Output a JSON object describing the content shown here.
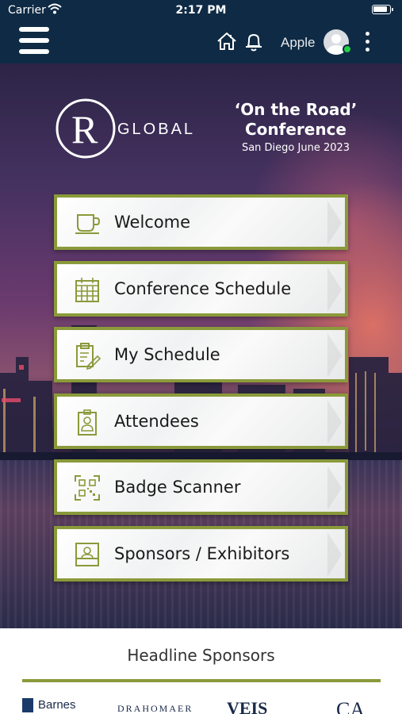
{
  "status_bar": {
    "carrier": "Carrier",
    "time": "2:17 PM"
  },
  "app_bar": {
    "user_name": "Apple",
    "icons": [
      "menu-icon",
      "home-icon",
      "bell-icon",
      "avatar-icon",
      "more-vertical-icon"
    ],
    "online_color": "#22d145"
  },
  "hero": {
    "logo_text": "GLOBAL",
    "logo_letter": "R",
    "conference": {
      "line1": "‘On the Road’",
      "line2": "Conference",
      "line3": "San Diego June 2023"
    }
  },
  "menu": {
    "accent_color": "#8a9a3a",
    "items": [
      {
        "label": "Welcome",
        "icon": "coffee-cup-icon"
      },
      {
        "label": "Conference Schedule",
        "icon": "calendar-icon"
      },
      {
        "label": "My Schedule",
        "icon": "clipboard-edit-icon"
      },
      {
        "label": "Attendees",
        "icon": "id-badge-icon"
      },
      {
        "label": "Badge Scanner",
        "icon": "qr-scan-icon"
      },
      {
        "label": "Sponsors / Exhibitors",
        "icon": "exhibitor-booth-icon"
      }
    ]
  },
  "sponsors": {
    "title": "Headline Sponsors",
    "logos": [
      "Barnes",
      "DRAHOMAER",
      "VEIS",
      "CA"
    ]
  }
}
